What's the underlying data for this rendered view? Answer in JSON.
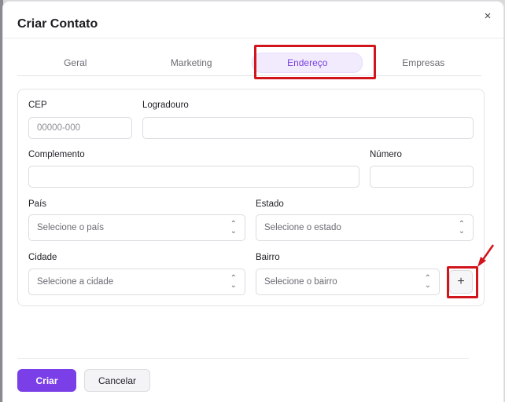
{
  "modal": {
    "title": "Criar Contato",
    "close_label": "×"
  },
  "tabs": [
    {
      "label": "Geral"
    },
    {
      "label": "Marketing"
    },
    {
      "label": "Endereço"
    },
    {
      "label": "Empresas"
    }
  ],
  "active_tab": "Endereço",
  "form": {
    "cep": {
      "label": "CEP",
      "placeholder": "00000-000"
    },
    "logradouro": {
      "label": "Logradouro",
      "placeholder": ""
    },
    "complemento": {
      "label": "Complemento",
      "placeholder": ""
    },
    "numero": {
      "label": "Número",
      "placeholder": ""
    },
    "pais": {
      "label": "País",
      "value": "Selecione o país"
    },
    "estado": {
      "label": "Estado",
      "value": "Selecione o estado"
    },
    "cidade": {
      "label": "Cidade",
      "value": "Selecione a cidade"
    },
    "bairro": {
      "label": "Bairro",
      "value": "Selecione o bairro"
    },
    "add_bairro_label": "+"
  },
  "footer": {
    "submit_label": "Criar",
    "cancel_label": "Cancelar"
  },
  "colors": {
    "accent": "#7b3fe8",
    "highlight": "#d2141b"
  },
  "icons": {
    "close": "close-icon",
    "select": "chevron-updown-icon",
    "add": "plus-icon",
    "annotation": "arrow-icon"
  }
}
